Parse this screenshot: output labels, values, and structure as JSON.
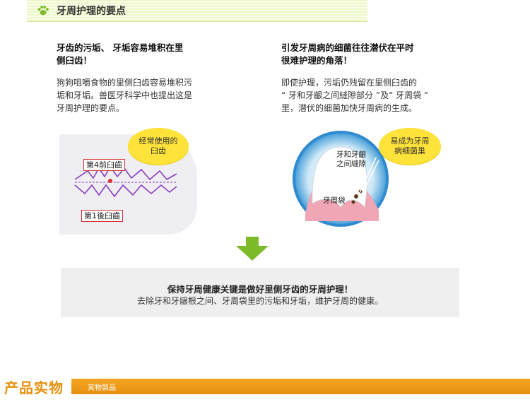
{
  "header": {
    "title": "牙周护理的要点",
    "icon": "paw-icon"
  },
  "left_section": {
    "heading_line1": "牙齿的污垢、 牙垢容易堆积在里",
    "heading_line2": "侧臼齿！",
    "body_line1": "狗狗咀嚼食物的里侧臼齿容易堆积污",
    "body_line2": "垢和牙垢。兽医牙科学中也提出这是",
    "body_line3": "牙周护理的要点。",
    "bubble_line1": "经常使用的",
    "bubble_line2": "臼齿",
    "label_front": "第4前臼齒",
    "label_back": "第1後臼齒"
  },
  "right_section": {
    "heading_line1": "引发牙周病的细菌往往潜伏在平时",
    "heading_line2": "很难护理的角落！",
    "body_line1": "即使护理，污垢仍残留在里侧臼齿的",
    "body_line2": "“ 牙和牙齦之间縫隙部分 ”及“ 牙周袋 ”",
    "body_line3": "里，潜伏的细菌加快牙周病的生成。",
    "bubble_line1": "易成为牙周",
    "bubble_line2": "病细菌巢",
    "label_gap_line1": "牙和牙齦",
    "label_gap_line2": "之间縫隙",
    "label_pocket": "牙周袋"
  },
  "summary": {
    "title": "保持牙周健康关键是做好里侧牙齿的牙周护理！",
    "subtitle": "去除牙和牙龈根之间、牙周袋里的污垢和牙垢，维护牙周的健康。"
  },
  "product": {
    "title": "产品实物",
    "subtitle": "実物製品"
  },
  "colors": {
    "accent_green": "#7dbb2a",
    "accent_orange": "#e8900f",
    "bubble_yellow": "#ffe23a",
    "label_red": "#d93030"
  }
}
